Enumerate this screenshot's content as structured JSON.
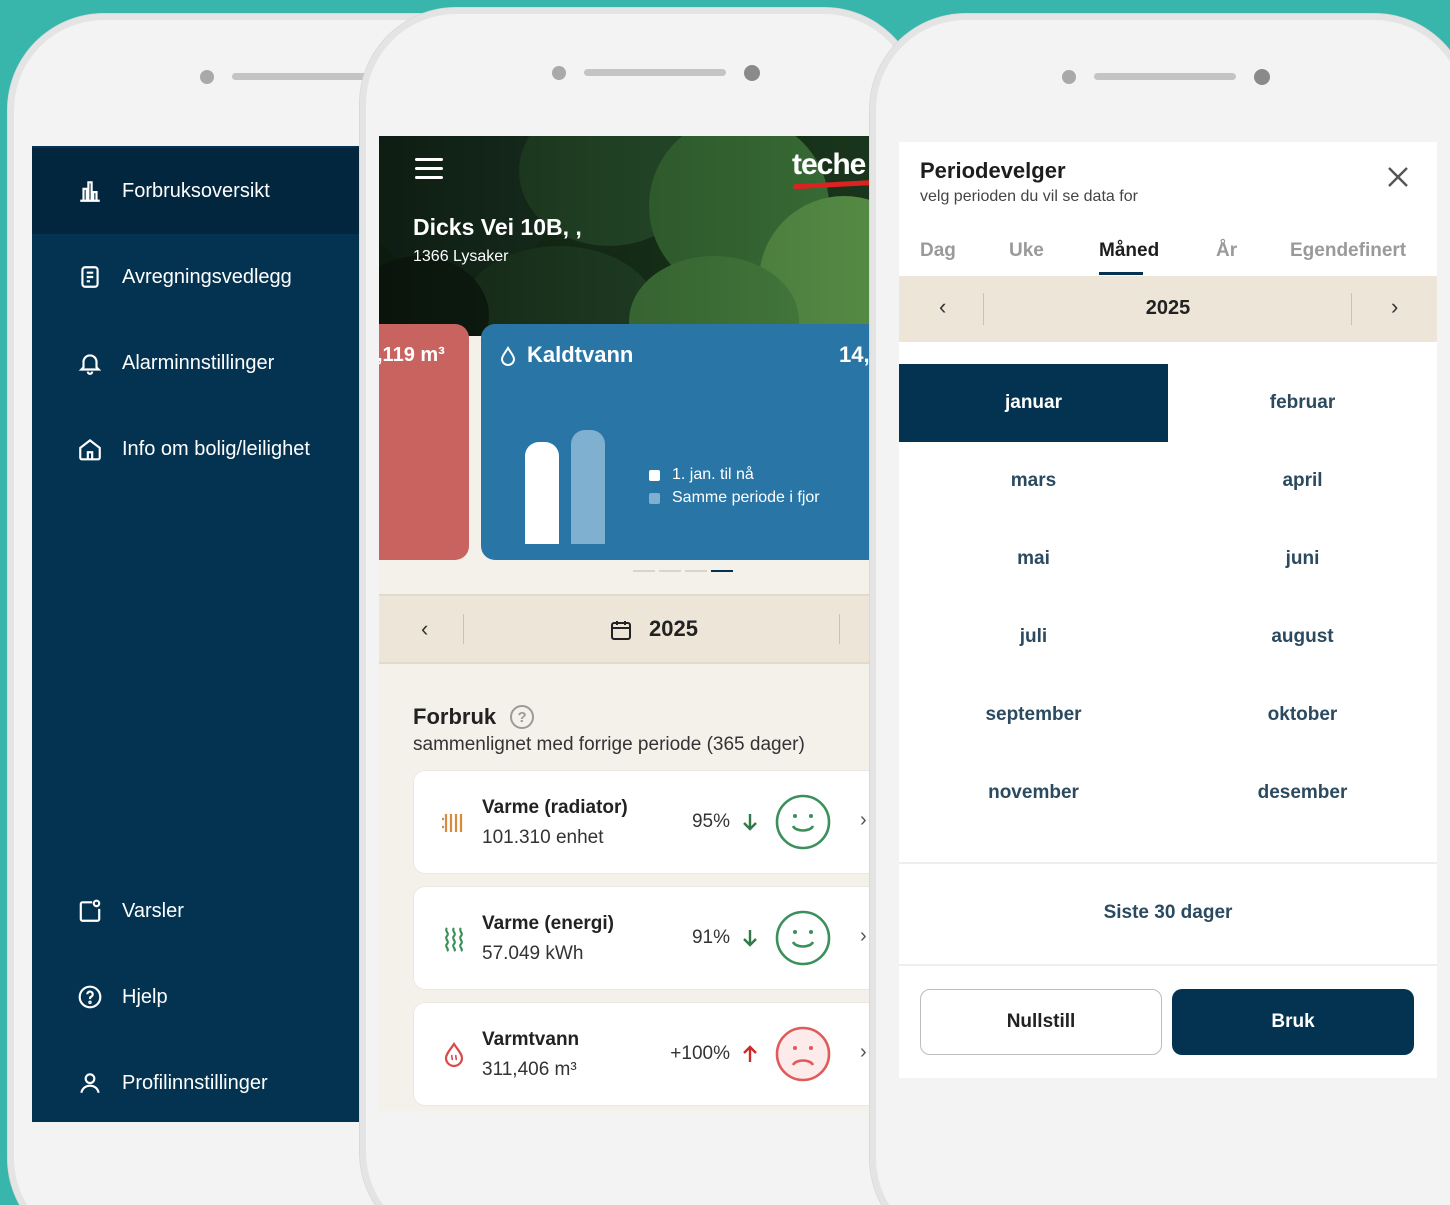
{
  "sidebar": {
    "items": [
      {
        "label": "Forbruksoversikt",
        "icon": "bar-chart-icon"
      },
      {
        "label": "Avregningsvedlegg",
        "icon": "document-icon"
      },
      {
        "label": "Alarminnstillinger",
        "icon": "bell-icon"
      },
      {
        "label": "Info om bolig/leilighet",
        "icon": "home-icon"
      }
    ],
    "bottom_items": [
      {
        "label": "Varsler",
        "icon": "notification-icon"
      },
      {
        "label": "Hjelp",
        "icon": "help-icon"
      },
      {
        "label": "Profilinnstillinger",
        "icon": "user-icon"
      }
    ]
  },
  "dashboard": {
    "logo": "teche",
    "address": "Dicks Vei 10B, ,",
    "city": "1366 Lysaker",
    "red_card_value": ",119 m³",
    "blue_card_title": "Kaldtvann",
    "blue_card_value": "14,",
    "legend": [
      "1. jan. til nå",
      "Samme periode i fjor"
    ],
    "year": "2025",
    "forbruk_title": "Forbruk",
    "forbruk_subtitle": "sammenlignet med forrige periode (365 dager)",
    "rows": [
      {
        "title": "Varme (radiator)",
        "sub": "101.310 enhet",
        "pct": "95%",
        "trend": "down",
        "mood": "happy"
      },
      {
        "title": "Varme (energi)",
        "sub": "57.049 kWh",
        "pct": "91%",
        "trend": "down",
        "mood": "happy"
      },
      {
        "title": "Varmtvann",
        "sub": "311,406 m³",
        "pct": "+100%",
        "trend": "up",
        "mood": "sad"
      }
    ]
  },
  "period_picker": {
    "title": "Periodevelger",
    "subtitle": "velg perioden du vil se data for",
    "tabs": [
      "Dag",
      "Uke",
      "Måned",
      "År",
      "Egendefinert"
    ],
    "active_tab": "Måned",
    "year": "2025",
    "months": [
      "januar",
      "februar",
      "mars",
      "april",
      "mai",
      "juni",
      "juli",
      "august",
      "september",
      "oktober",
      "november",
      "desember"
    ],
    "selected_month": "januar",
    "last30": "Siste 30 dager",
    "reset_label": "Nullstill",
    "apply_label": "Bruk"
  },
  "colors": {
    "background": "#38b6ac",
    "navy": "#033350",
    "card_blue": "#2976a6",
    "card_red": "#c86360",
    "sand": "#ede6d8",
    "happy_green": "#3a8f5a",
    "sad_red": "#e05a5a"
  }
}
